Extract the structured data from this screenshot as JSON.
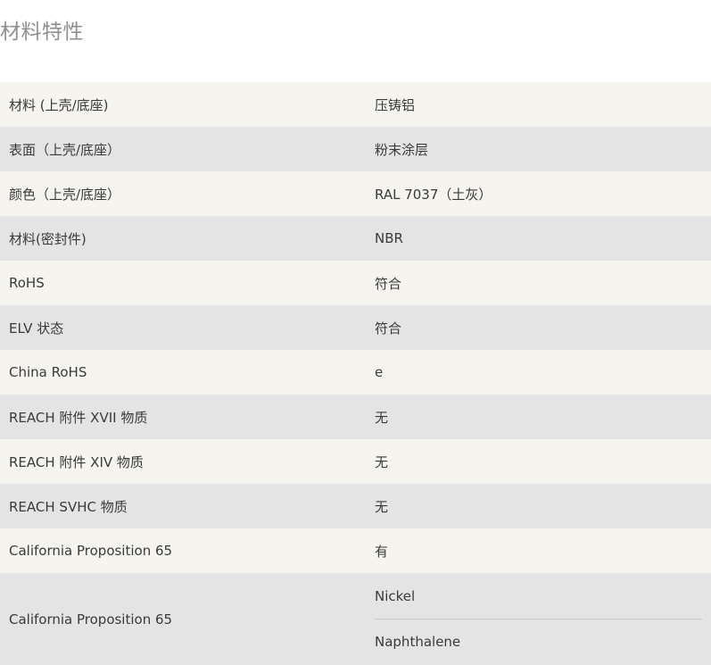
{
  "section": {
    "title": "材料特性"
  },
  "properties": [
    {
      "label": "材料 (上壳/底座)",
      "value": "压铸铝"
    },
    {
      "label": "表面（上壳/底座）",
      "value": "粉末涂层"
    },
    {
      "label": "颜色（上壳/底座）",
      "value": "RAL 7037（土灰）"
    },
    {
      "label": "材料(密封件)",
      "value": "NBR"
    },
    {
      "label": "RoHS",
      "value": "符合"
    },
    {
      "label": "ELV 状态",
      "value": "符合"
    },
    {
      "label": "China RoHS",
      "value": "e"
    },
    {
      "label": "REACH 附件 XVII 物质",
      "value": "无"
    },
    {
      "label": "REACH 附件 XIV 物质",
      "value": "无"
    },
    {
      "label": "REACH SVHC 物质",
      "value": "无"
    },
    {
      "label": "California Proposition 65",
      "value": "有"
    },
    {
      "label": "California Proposition 65",
      "values": [
        "Nickel",
        "Naphthalene"
      ]
    }
  ]
}
